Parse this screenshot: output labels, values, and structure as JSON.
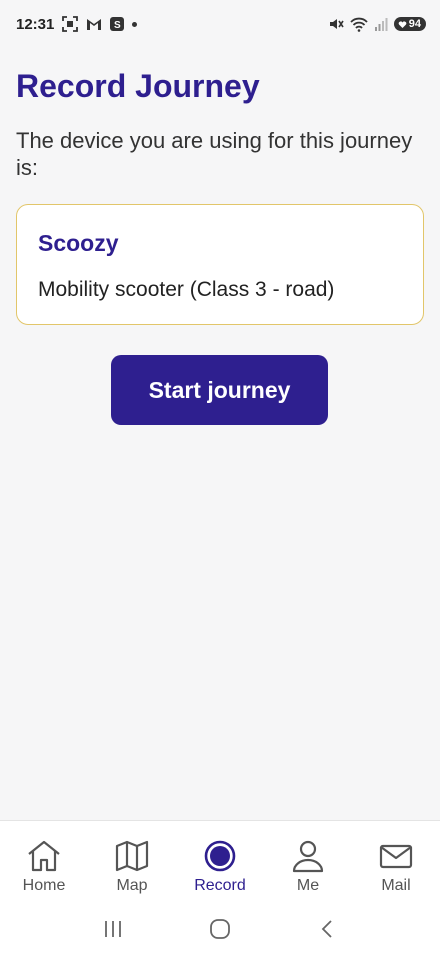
{
  "status": {
    "time": "12:31",
    "battery": "94",
    "left_icons": [
      "screenshot-icon",
      "gmail-icon",
      "app-notification-icon",
      "dot-icon"
    ],
    "right_icons": [
      "mute-icon",
      "wifi-icon",
      "signal-icon",
      "battery-icon"
    ]
  },
  "page": {
    "title": "Record Journey",
    "intro": "The device you are using for this journey is:"
  },
  "device": {
    "name": "Scoozy",
    "type": "Mobility scooter (Class 3 - road)"
  },
  "actions": {
    "start_label": "Start journey"
  },
  "nav": {
    "items": [
      {
        "label": "Home",
        "icon": "home-icon"
      },
      {
        "label": "Map",
        "icon": "map-icon"
      },
      {
        "label": "Record",
        "icon": "record-icon",
        "active": true
      },
      {
        "label": "Me",
        "icon": "person-icon"
      },
      {
        "label": "Mail",
        "icon": "mail-icon"
      }
    ]
  },
  "colors": {
    "brand": "#2e1f8f",
    "card_border": "#e2c66a",
    "background": "#f6f6f7"
  }
}
